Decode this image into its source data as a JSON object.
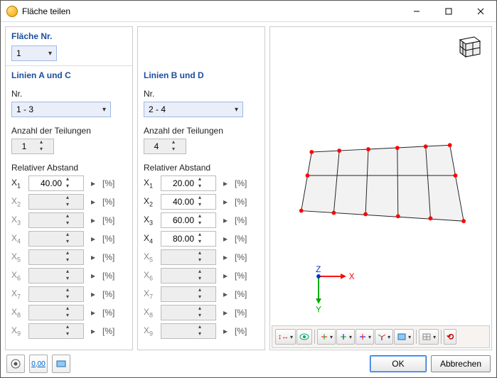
{
  "window": {
    "title": "Fläche teilen"
  },
  "left": {
    "header_surface": "Fläche Nr.",
    "surface_no": "1",
    "header_lines": "Linien A und C",
    "nr_label": "Nr.",
    "nr_value": "1 - 3",
    "div_label": "Anzahl der Teilungen",
    "div_value": "1",
    "rel_label": "Relativer Abstand",
    "pct": "[%]",
    "rows": [
      {
        "label": "X",
        "idx": "1",
        "val": "40.00",
        "enabled": true
      },
      {
        "label": "X",
        "idx": "2",
        "val": "",
        "enabled": false
      },
      {
        "label": "X",
        "idx": "3",
        "val": "",
        "enabled": false
      },
      {
        "label": "X",
        "idx": "4",
        "val": "",
        "enabled": false
      },
      {
        "label": "X",
        "idx": "5",
        "val": "",
        "enabled": false
      },
      {
        "label": "X",
        "idx": "6",
        "val": "",
        "enabled": false
      },
      {
        "label": "X",
        "idx": "7",
        "val": "",
        "enabled": false
      },
      {
        "label": "X",
        "idx": "8",
        "val": "",
        "enabled": false
      },
      {
        "label": "X",
        "idx": "9",
        "val": "",
        "enabled": false
      }
    ]
  },
  "mid": {
    "header_lines": "Linien B und D",
    "nr_label": "Nr.",
    "nr_value": "2 - 4",
    "div_label": "Anzahl der Teilungen",
    "div_value": "4",
    "rel_label": "Relativer Abstand",
    "pct": "[%]",
    "rows": [
      {
        "label": "X",
        "idx": "1",
        "val": "20.00",
        "enabled": true
      },
      {
        "label": "X",
        "idx": "2",
        "val": "40.00",
        "enabled": true
      },
      {
        "label": "X",
        "idx": "3",
        "val": "60.00",
        "enabled": true
      },
      {
        "label": "X",
        "idx": "4",
        "val": "80.00",
        "enabled": true
      },
      {
        "label": "X",
        "idx": "5",
        "val": "",
        "enabled": false
      },
      {
        "label": "X",
        "idx": "6",
        "val": "",
        "enabled": false
      },
      {
        "label": "X",
        "idx": "7",
        "val": "",
        "enabled": false
      },
      {
        "label": "X",
        "idx": "8",
        "val": "",
        "enabled": false
      },
      {
        "label": "X",
        "idx": "9",
        "val": "",
        "enabled": false
      }
    ]
  },
  "axes": {
    "x": "X",
    "y": "Y",
    "z": "Z"
  },
  "footer": {
    "ok": "OK",
    "cancel": "Abbrechen",
    "units": "0,00"
  }
}
